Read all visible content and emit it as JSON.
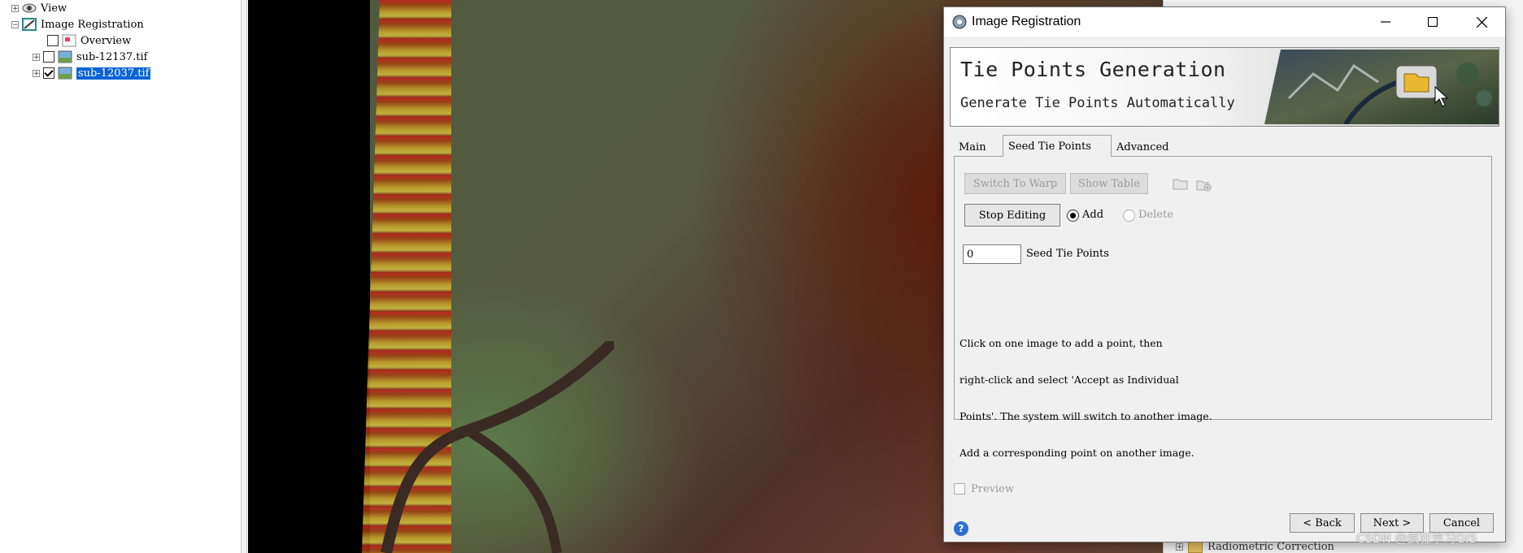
{
  "tree": {
    "items": [
      {
        "label": "View",
        "expander": "+",
        "checked": null
      },
      {
        "label": "Image Registration",
        "expander": "−",
        "checked": null
      },
      {
        "label": "Overview",
        "expander": "",
        "checked": false
      },
      {
        "label": "sub-12137.tif",
        "expander": "+",
        "checked": false
      },
      {
        "label": "sub-12037.tif",
        "expander": "+",
        "checked": true,
        "selected": true
      }
    ]
  },
  "background": {
    "bottom_label": "Radiometric Correction",
    "expander": "+"
  },
  "dialog": {
    "title": "Image Registration",
    "banner": {
      "title": "Tie Points Generation",
      "subtitle": "Generate Tie Points Automatically"
    },
    "tabs": [
      {
        "label": "Main",
        "active": false
      },
      {
        "label": "Seed Tie Points",
        "active": true
      },
      {
        "label": "Advanced",
        "active": false
      }
    ],
    "seed_tab": {
      "switch_to_warp_label": "Switch To Warp",
      "show_table_label": "Show Table",
      "stop_editing_label": "Stop Editing",
      "add_label": "Add",
      "delete_label": "Delete",
      "mode_selected": "Add",
      "seed_count_value": "0",
      "seed_count_label": "Seed Tie Points",
      "instructions": [
        "Click on one image to add a point, then",
        "right-click and select 'Accept as Individual",
        "Points'. The system will switch to another image.",
        "Add a corresponding point on another image."
      ]
    },
    "preview_label": "Preview",
    "preview_checked": false,
    "buttons": {
      "back": "< Back",
      "next": "Next >",
      "cancel": "Cancel"
    }
  },
  "watermark": "CSDN @疯狂学习GIS",
  "colors": {
    "selection": "#0a64d6",
    "help": "#2f6fd0"
  }
}
